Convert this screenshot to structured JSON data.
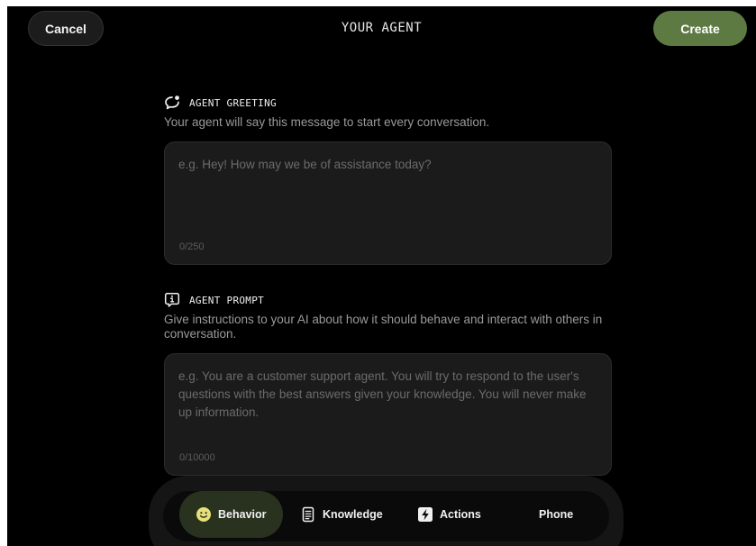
{
  "header": {
    "cancel_label": "Cancel",
    "title": "YOUR AGENT",
    "create_label": "Create"
  },
  "greeting": {
    "icon": "chat-bubble-icon",
    "title": "AGENT GREETING",
    "description": "Your agent will say this message to start every conversation.",
    "placeholder": "e.g. Hey! How may we be of assistance today?",
    "counter": "0/250"
  },
  "prompt": {
    "icon": "info-bubble-icon",
    "title": "AGENT PROMPT",
    "description": "Give instructions to your AI about how it should behave and interact with others in conversation.",
    "placeholder": "e.g. You are a customer support agent. You will try to respond to the user's questions with the best answers given your knowledge. You will never make up information.",
    "counter": "0/10000"
  },
  "tabs": [
    {
      "label": "Behavior",
      "icon": "smiley-icon",
      "active": true
    },
    {
      "label": "Knowledge",
      "icon": "document-icon",
      "active": false
    },
    {
      "label": "Actions",
      "icon": "lightning-icon",
      "active": false
    },
    {
      "label": "Phone",
      "icon": "",
      "active": false
    }
  ],
  "colors": {
    "background": "#000000",
    "accent": "#5e7a43",
    "active_tab": "#28321f",
    "smiley_yellow": "#e6df7a",
    "textbox": "#1b1b1b"
  }
}
